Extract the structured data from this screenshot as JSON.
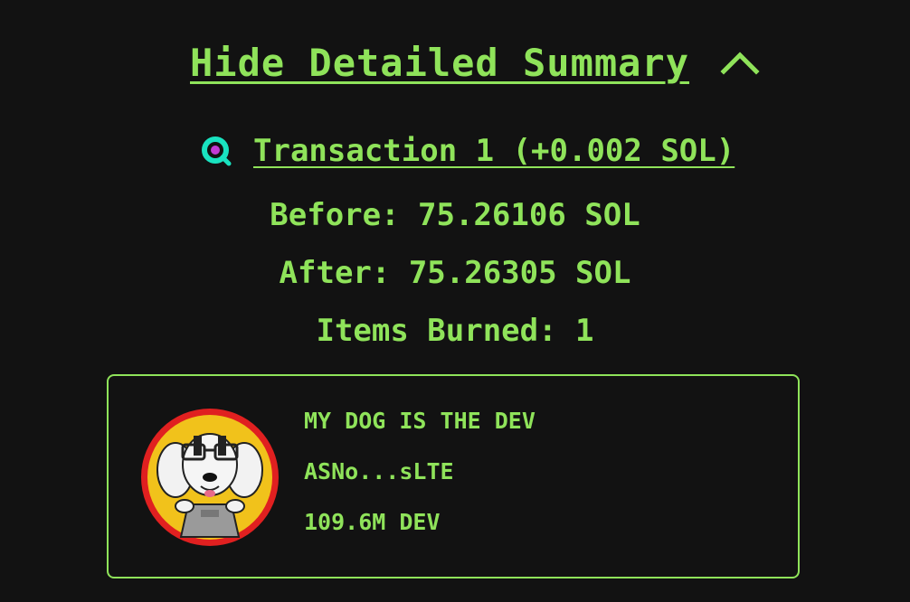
{
  "summary": {
    "toggle_label": "Hide Detailed Summary",
    "toggle_icon": "chevron-up-icon"
  },
  "transaction": {
    "icon": "search-icon",
    "link_label": "Transaction 1 (+0.002 SOL)",
    "before": "Before: 75.26106 SOL",
    "after": "After: 75.26305 SOL",
    "items_burned": "Items Burned: 1"
  },
  "item": {
    "avatar": "dog-token-avatar",
    "name": "MY DOG IS THE DEV",
    "address": "ASNo...sLTE",
    "amount": "109.6M DEV"
  },
  "colors": {
    "background": "#121212",
    "accent": "#8fe35a",
    "avatar_ring": "#e02020",
    "avatar_fill": "#f1c21b",
    "icon_ring": "#19e3c0",
    "icon_center": "#c23bd4"
  }
}
